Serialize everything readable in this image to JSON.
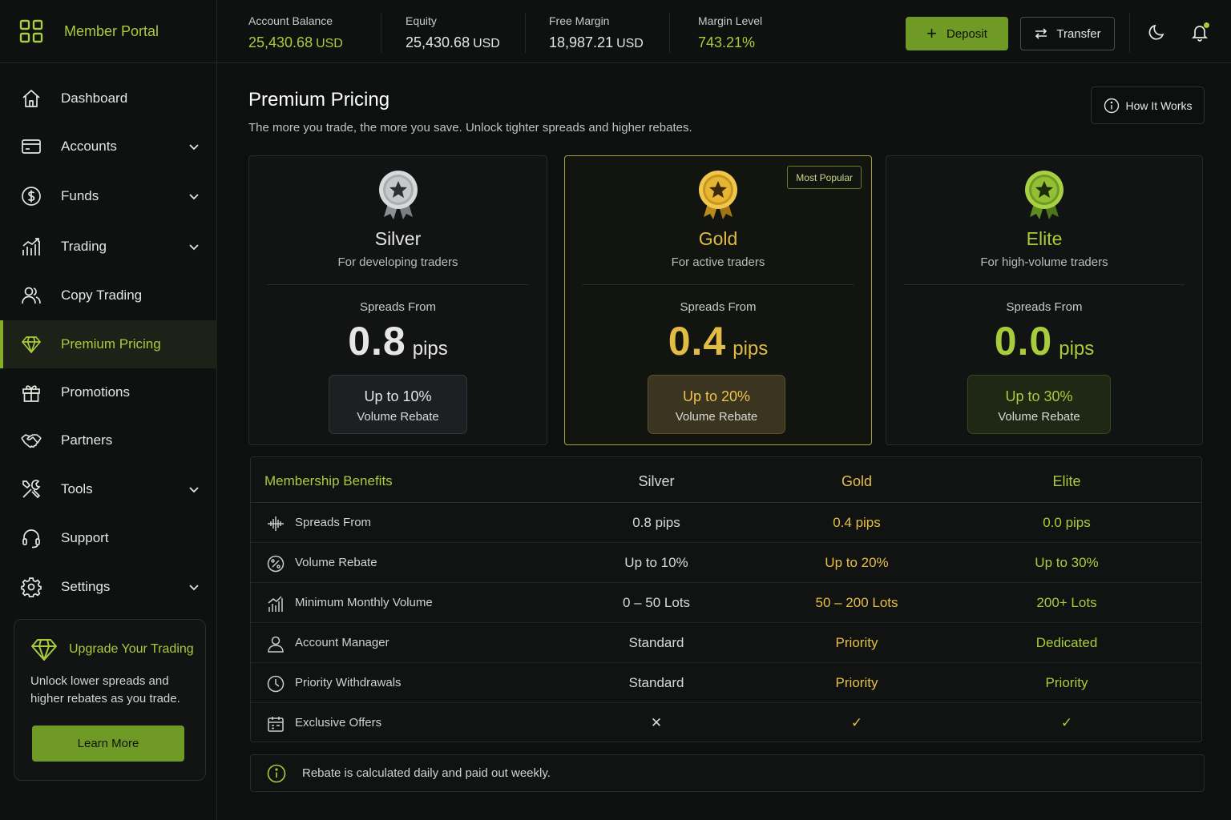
{
  "brand": {
    "name": "Member Portal",
    "logo_icon": "grid-icon"
  },
  "sidebar": {
    "items": [
      {
        "label": "Dashboard",
        "icon": "home-icon",
        "expandable": false,
        "active": false
      },
      {
        "label": "Accounts",
        "icon": "card-icon",
        "expandable": true,
        "active": false
      },
      {
        "label": "Funds",
        "icon": "dollar-icon",
        "expandable": true,
        "active": false
      },
      {
        "label": "Trading",
        "icon": "chart-icon",
        "expandable": true,
        "active": false
      },
      {
        "label": "Copy Trading",
        "icon": "users-icon",
        "expandable": false,
        "active": false
      },
      {
        "label": "Premium Pricing",
        "icon": "diamond-icon",
        "expandable": false,
        "active": true
      },
      {
        "label": "Promotions",
        "icon": "gift-icon",
        "expandable": false,
        "active": false
      },
      {
        "label": "Partners",
        "icon": "handshake-icon",
        "expandable": false,
        "active": false
      },
      {
        "label": "Tools",
        "icon": "tools-icon",
        "expandable": true,
        "active": false
      },
      {
        "label": "Support",
        "icon": "headset-icon",
        "expandable": false,
        "active": false
      },
      {
        "label": "Settings",
        "icon": "gear-icon",
        "expandable": true,
        "active": false
      }
    ],
    "upgrade": {
      "title": "Upgrade Your Trading",
      "text": "Unlock lower spreads and higher rebates as you trade.",
      "button": "Learn More"
    }
  },
  "header": {
    "stats": [
      {
        "label": "Account Balance",
        "value": "25,430.68",
        "unit": "USD",
        "accent": true
      },
      {
        "label": "Equity",
        "value": "25,430.68",
        "unit": "USD",
        "accent": false
      },
      {
        "label": "Free Margin",
        "value": "18,987.21",
        "unit": "USD",
        "accent": false
      },
      {
        "label": "Margin Level",
        "value": "743.21%",
        "unit": "",
        "accent": true
      }
    ],
    "deposit_label": "Deposit",
    "transfer_label": "Transfer"
  },
  "main": {
    "title": "Premium Pricing",
    "subtitle": "The more you trade, the more you save. Unlock tighter spreads and higher rebates.",
    "how_label": "How It Works",
    "tiers": [
      {
        "name": "Silver",
        "desc": "For developing traders",
        "spreads_label": "Spreads From",
        "spread": "0.8",
        "unit": "pips",
        "rebate": "Up to 10%",
        "rebate_label": "Volume Rebate",
        "badge": ""
      },
      {
        "name": "Gold",
        "desc": "For active traders",
        "spreads_label": "Spreads From",
        "spread": "0.4",
        "unit": "pips",
        "rebate": "Up to 20%",
        "rebate_label": "Volume Rebate",
        "badge": "Most Popular"
      },
      {
        "name": "Elite",
        "desc": "For high-volume traders",
        "spreads_label": "Spreads From",
        "spread": "0.0",
        "unit": "pips",
        "rebate": "Up to 30%",
        "rebate_label": "Volume Rebate",
        "badge": ""
      }
    ],
    "table": {
      "headers": [
        "Membership Benefits",
        "Silver",
        "Gold",
        "Elite"
      ],
      "rows": [
        {
          "label": "Spreads From",
          "icon": "waveform-icon",
          "silver": "0.8 pips",
          "gold": "0.4 pips",
          "elite": "0.0 pips"
        },
        {
          "label": "Volume Rebate",
          "icon": "percent-icon",
          "silver": "Up to 10%",
          "gold": "Up to 20%",
          "elite": "Up to 30%"
        },
        {
          "label": "Minimum Monthly Volume",
          "icon": "bar-chart-icon",
          "silver": "0 – 50 Lots",
          "gold": "50 – 200 Lots",
          "elite": "200+ Lots"
        },
        {
          "label": "Account Manager",
          "icon": "user-icon",
          "silver": "Standard",
          "gold": "Priority",
          "elite": "Dedicated"
        },
        {
          "label": "Priority Withdrawals",
          "icon": "clock-icon",
          "silver": "Standard",
          "gold": "Priority",
          "elite": "Priority"
        },
        {
          "label": "Exclusive Offers",
          "icon": "calendar-icon",
          "silver": "✕",
          "gold": "✓",
          "elite": "✓"
        }
      ]
    },
    "note": "Rebate is calculated daily and paid out weekly."
  },
  "colors": {
    "accent": "#a8cc3c",
    "gold": "#e0bb45",
    "background": "#0e100f"
  }
}
